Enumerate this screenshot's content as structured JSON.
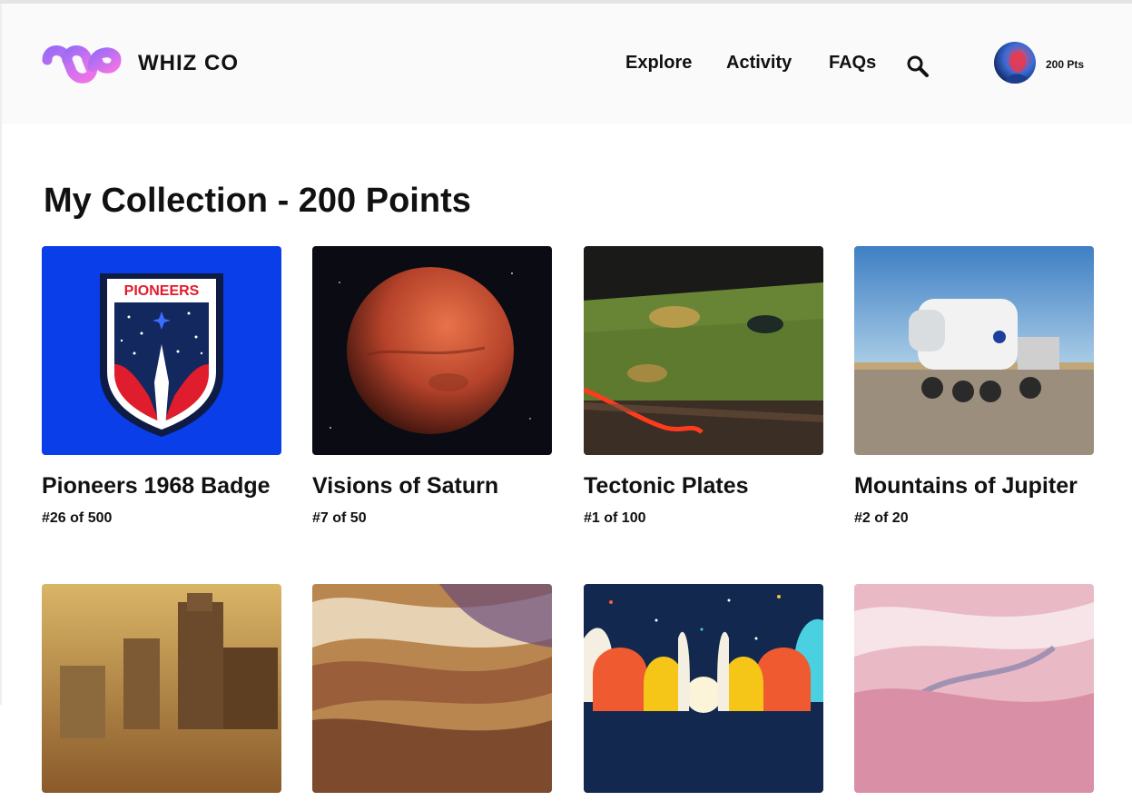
{
  "brand": {
    "name": "WHIZ CO"
  },
  "nav": {
    "items": [
      {
        "label": "Explore"
      },
      {
        "label": "Activity"
      },
      {
        "label": "FAQs"
      }
    ],
    "search_icon": "search-icon"
  },
  "user": {
    "points_label": "200 Pts",
    "avatar_icon": "avatar"
  },
  "page": {
    "title": "My Collection - 200 Points"
  },
  "collection": [
    {
      "title": "Pioneers 1968 Badge",
      "edition": "#26 of 500",
      "badge_text": "PIONEERS"
    },
    {
      "title": "Visions of Saturn",
      "edition": "#7 of 50"
    },
    {
      "title": "Tectonic Plates",
      "edition": "#1 of 100"
    },
    {
      "title": "Mountains of Jupiter",
      "edition": "#2 of 20"
    },
    {
      "title": "",
      "edition": ""
    },
    {
      "title": "",
      "edition": ""
    },
    {
      "title": "",
      "edition": ""
    },
    {
      "title": "",
      "edition": ""
    }
  ],
  "colors": {
    "brand_gradient_start": "#c77dff",
    "brand_gradient_end": "#e86cf2",
    "badge_blue": "#0a3ee8"
  }
}
